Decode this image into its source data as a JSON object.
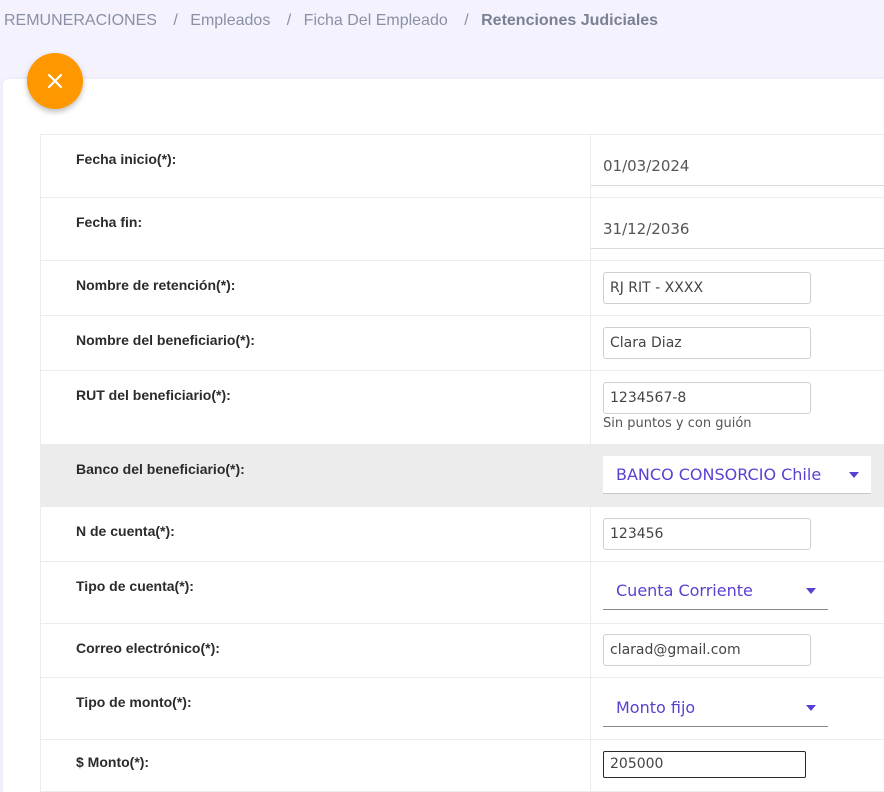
{
  "breadcrumb": {
    "items": [
      "REMUNERACIONES",
      "Empleados",
      "Ficha Del Empleado"
    ],
    "current": "Retenciones Judiciales",
    "separator": "/"
  },
  "close_button": {
    "icon": "close-icon",
    "color": "#ff9800"
  },
  "form": {
    "fecha_inicio": {
      "label": "Fecha inicio(*):",
      "value": "01/03/2024"
    },
    "fecha_fin": {
      "label": "Fecha fin:",
      "value": "31/12/2036"
    },
    "nombre_retencion": {
      "label": "Nombre de retención(*):",
      "value": "RJ RIT - XXXX"
    },
    "nombre_beneficiario": {
      "label": "Nombre del beneficiario(*):",
      "value": "Clara Diaz"
    },
    "rut_beneficiario": {
      "label": "RUT del beneficiario(*):",
      "value": "1234567-8",
      "hint": "Sin puntos y con guión"
    },
    "banco_beneficiario": {
      "label": "Banco del beneficiario(*):",
      "value": "BANCO CONSORCIO Chile"
    },
    "n_cuenta": {
      "label": "N de cuenta(*):",
      "value": "123456"
    },
    "tipo_cuenta": {
      "label": "Tipo de cuenta(*):",
      "value": "Cuenta Corriente"
    },
    "correo": {
      "label": "Correo electrónico(*):",
      "value": "clarad@gmail.com"
    },
    "tipo_monto": {
      "label": "Tipo de monto(*):",
      "value": "Monto fijo"
    },
    "monto": {
      "label": "$ Monto(*):",
      "value": "205000"
    }
  },
  "colors": {
    "accent": "#5b3fd1",
    "row_highlight": "#ececec"
  }
}
